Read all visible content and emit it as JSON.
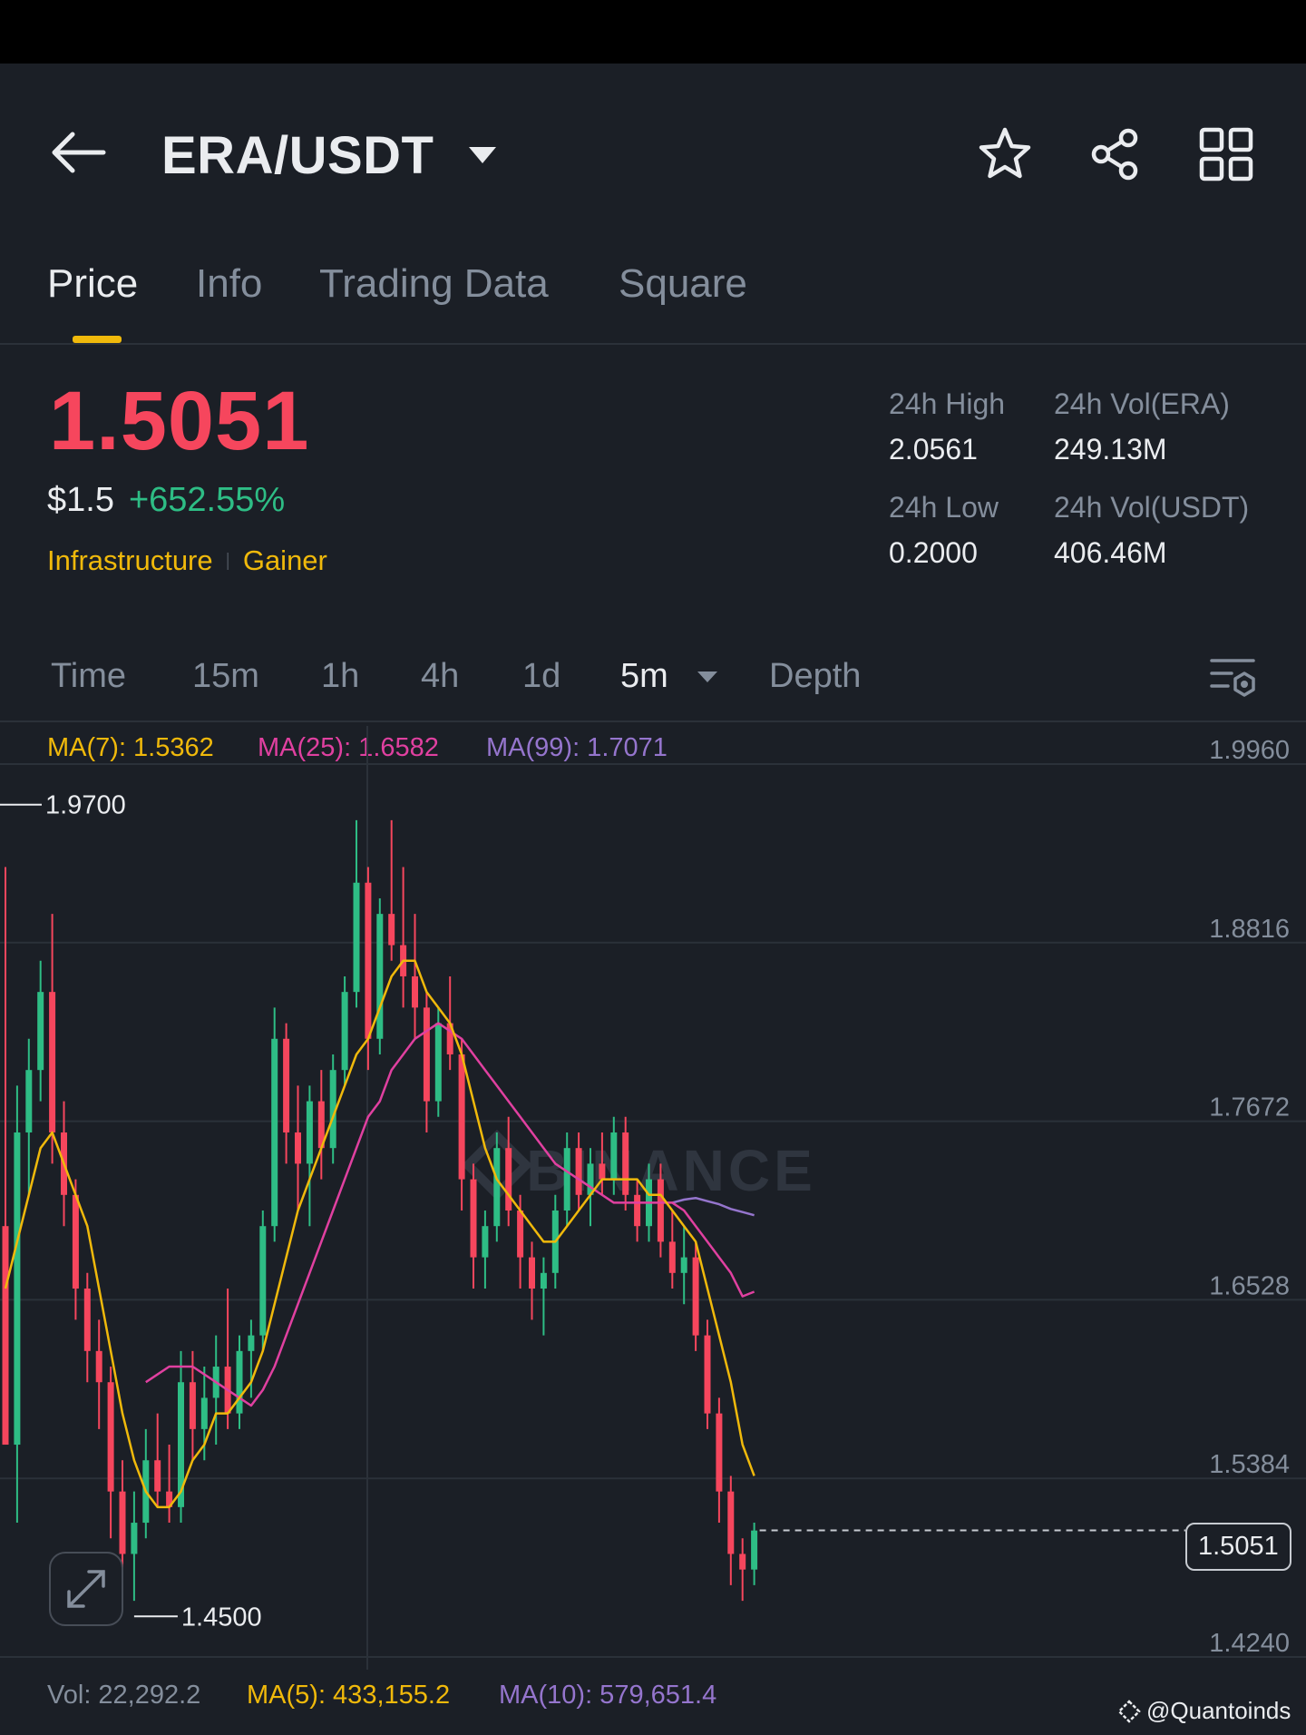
{
  "header": {
    "title": "ERA/USDT"
  },
  "tabs": [
    {
      "label": "Price"
    },
    {
      "label": "Info"
    },
    {
      "label": "Trading Data"
    },
    {
      "label": "Square"
    }
  ],
  "ticker": {
    "price": "1.5051",
    "fiat": "$1.5",
    "change": "+652.55%",
    "tags": [
      "Infrastructure",
      "Gainer"
    ],
    "high_label": "24h High",
    "high_value": "2.0561",
    "low_label": "24h Low",
    "low_value": "0.2000",
    "vol_base_label": "24h Vol(ERA)",
    "vol_base_value": "249.13M",
    "vol_quote_label": "24h Vol(USDT)",
    "vol_quote_value": "406.46M"
  },
  "timeframes": {
    "time": "Time",
    "m15": "15m",
    "h1": "1h",
    "h4": "4h",
    "d1": "1d",
    "selected": "5m",
    "depth": "Depth"
  },
  "indicators": {
    "ma7": "MA(7): 1.5362",
    "ma25": "MA(25): 1.6582",
    "ma99": "MA(99): 1.7071"
  },
  "volume": {
    "vol": "Vol: 22,292.2",
    "ma5": "MA(5): 433,155.2",
    "ma10": "MA(10): 579,651.4"
  },
  "watermark": "BINANCE",
  "credit": "@Quantoinds",
  "colors": {
    "up": "#2ebd85",
    "down": "#f6465d",
    "accent": "#f0b90b",
    "ma7": "#f0b90b",
    "ma25": "#e040a0",
    "ma99": "#9575cd"
  },
  "chart_data": {
    "type": "candlestick",
    "interval": "5m",
    "y_ticks": [
      "1.9960",
      "1.8816",
      "1.7672",
      "1.6528",
      "1.5384",
      "1.4240"
    ],
    "ylim": [
      1.424,
      1.996
    ],
    "grid": true,
    "last_price": "1.5051",
    "high_marker": "1.9700",
    "low_marker": "1.4500",
    "candles": [
      [
        1.7,
        1.93,
        1.6,
        1.56
      ],
      [
        1.56,
        1.79,
        1.51,
        1.76
      ],
      [
        1.76,
        1.82,
        1.72,
        1.8
      ],
      [
        1.8,
        1.87,
        1.78,
        1.85
      ],
      [
        1.85,
        1.9,
        1.74,
        1.76
      ],
      [
        1.76,
        1.78,
        1.7,
        1.72
      ],
      [
        1.72,
        1.73,
        1.64,
        1.66
      ],
      [
        1.66,
        1.67,
        1.6,
        1.62
      ],
      [
        1.62,
        1.64,
        1.57,
        1.6
      ],
      [
        1.6,
        1.61,
        1.5,
        1.53
      ],
      [
        1.53,
        1.55,
        1.47,
        1.49
      ],
      [
        1.49,
        1.53,
        1.46,
        1.51
      ],
      [
        1.51,
        1.57,
        1.5,
        1.55
      ],
      [
        1.55,
        1.58,
        1.52,
        1.53
      ],
      [
        1.53,
        1.56,
        1.51,
        1.52
      ],
      [
        1.52,
        1.62,
        1.51,
        1.6
      ],
      [
        1.6,
        1.62,
        1.55,
        1.57
      ],
      [
        1.57,
        1.61,
        1.55,
        1.59
      ],
      [
        1.59,
        1.63,
        1.56,
        1.61
      ],
      [
        1.61,
        1.66,
        1.57,
        1.58
      ],
      [
        1.58,
        1.63,
        1.57,
        1.62
      ],
      [
        1.62,
        1.64,
        1.59,
        1.63
      ],
      [
        1.63,
        1.71,
        1.62,
        1.7
      ],
      [
        1.7,
        1.84,
        1.69,
        1.82
      ],
      [
        1.82,
        1.83,
        1.74,
        1.76
      ],
      [
        1.76,
        1.79,
        1.71,
        1.74
      ],
      [
        1.74,
        1.79,
        1.7,
        1.78
      ],
      [
        1.78,
        1.8,
        1.73,
        1.75
      ],
      [
        1.75,
        1.81,
        1.74,
        1.8
      ],
      [
        1.8,
        1.86,
        1.79,
        1.85
      ],
      [
        1.85,
        1.96,
        1.84,
        1.92
      ],
      [
        1.92,
        1.93,
        1.8,
        1.82
      ],
      [
        1.82,
        1.91,
        1.81,
        1.9
      ],
      [
        1.9,
        1.96,
        1.87,
        1.88
      ],
      [
        1.88,
        1.93,
        1.84,
        1.86
      ],
      [
        1.86,
        1.9,
        1.82,
        1.84
      ],
      [
        1.84,
        1.85,
        1.76,
        1.78
      ],
      [
        1.78,
        1.84,
        1.77,
        1.83
      ],
      [
        1.83,
        1.86,
        1.8,
        1.81
      ],
      [
        1.81,
        1.82,
        1.71,
        1.73
      ],
      [
        1.73,
        1.74,
        1.66,
        1.68
      ],
      [
        1.68,
        1.71,
        1.66,
        1.7
      ],
      [
        1.7,
        1.76,
        1.69,
        1.75
      ],
      [
        1.75,
        1.77,
        1.7,
        1.71
      ],
      [
        1.71,
        1.72,
        1.66,
        1.68
      ],
      [
        1.68,
        1.69,
        1.64,
        1.66
      ],
      [
        1.66,
        1.68,
        1.63,
        1.67
      ],
      [
        1.67,
        1.72,
        1.66,
        1.71
      ],
      [
        1.71,
        1.76,
        1.7,
        1.75
      ],
      [
        1.75,
        1.76,
        1.71,
        1.72
      ],
      [
        1.72,
        1.75,
        1.7,
        1.74
      ],
      [
        1.74,
        1.76,
        1.72,
        1.73
      ],
      [
        1.73,
        1.77,
        1.72,
        1.76
      ],
      [
        1.76,
        1.77,
        1.71,
        1.72
      ],
      [
        1.72,
        1.73,
        1.69,
        1.7
      ],
      [
        1.7,
        1.74,
        1.69,
        1.73
      ],
      [
        1.73,
        1.74,
        1.68,
        1.69
      ],
      [
        1.69,
        1.71,
        1.66,
        1.67
      ],
      [
        1.67,
        1.7,
        1.65,
        1.68
      ],
      [
        1.68,
        1.69,
        1.62,
        1.63
      ],
      [
        1.63,
        1.64,
        1.57,
        1.58
      ],
      [
        1.58,
        1.59,
        1.51,
        1.53
      ],
      [
        1.53,
        1.54,
        1.47,
        1.49
      ],
      [
        1.49,
        1.5,
        1.46,
        1.48
      ],
      [
        1.48,
        1.51,
        1.47,
        1.505
      ]
    ],
    "ma7": [
      1.66,
      1.69,
      1.72,
      1.75,
      1.76,
      1.74,
      1.72,
      1.7,
      1.66,
      1.62,
      1.58,
      1.55,
      1.53,
      1.52,
      1.52,
      1.53,
      1.55,
      1.56,
      1.58,
      1.58,
      1.59,
      1.6,
      1.62,
      1.65,
      1.68,
      1.71,
      1.73,
      1.75,
      1.77,
      1.79,
      1.81,
      1.82,
      1.84,
      1.86,
      1.87,
      1.87,
      1.85,
      1.84,
      1.83,
      1.81,
      1.78,
      1.75,
      1.73,
      1.72,
      1.71,
      1.7,
      1.69,
      1.69,
      1.7,
      1.71,
      1.72,
      1.73,
      1.73,
      1.73,
      1.73,
      1.72,
      1.72,
      1.71,
      1.7,
      1.69,
      1.66,
      1.63,
      1.6,
      1.56,
      1.54
    ],
    "ma25": [
      null,
      null,
      null,
      null,
      null,
      null,
      null,
      null,
      null,
      null,
      null,
      null,
      1.6,
      1.605,
      1.61,
      1.61,
      1.61,
      1.605,
      1.6,
      1.595,
      1.59,
      1.585,
      1.595,
      1.61,
      1.63,
      1.65,
      1.67,
      1.69,
      1.71,
      1.73,
      1.75,
      1.77,
      1.78,
      1.8,
      1.81,
      1.82,
      1.825,
      1.83,
      1.825,
      1.82,
      1.81,
      1.8,
      1.79,
      1.78,
      1.77,
      1.76,
      1.75,
      1.74,
      1.735,
      1.73,
      1.725,
      1.72,
      1.715,
      1.715,
      1.715,
      1.715,
      1.715,
      1.715,
      1.71,
      1.7,
      1.69,
      1.68,
      1.67,
      1.655,
      1.658
    ],
    "ma99": [
      null,
      null,
      null,
      null,
      null,
      null,
      null,
      null,
      null,
      null,
      null,
      null,
      null,
      null,
      null,
      null,
      null,
      null,
      null,
      null,
      null,
      null,
      null,
      null,
      null,
      null,
      null,
      null,
      null,
      null,
      null,
      null,
      null,
      null,
      null,
      null,
      null,
      null,
      null,
      null,
      null,
      null,
      null,
      null,
      null,
      null,
      null,
      null,
      null,
      null,
      null,
      null,
      null,
      null,
      null,
      null,
      null,
      1.715,
      1.717,
      1.718,
      1.716,
      1.714,
      1.711,
      1.709,
      1.707
    ]
  }
}
